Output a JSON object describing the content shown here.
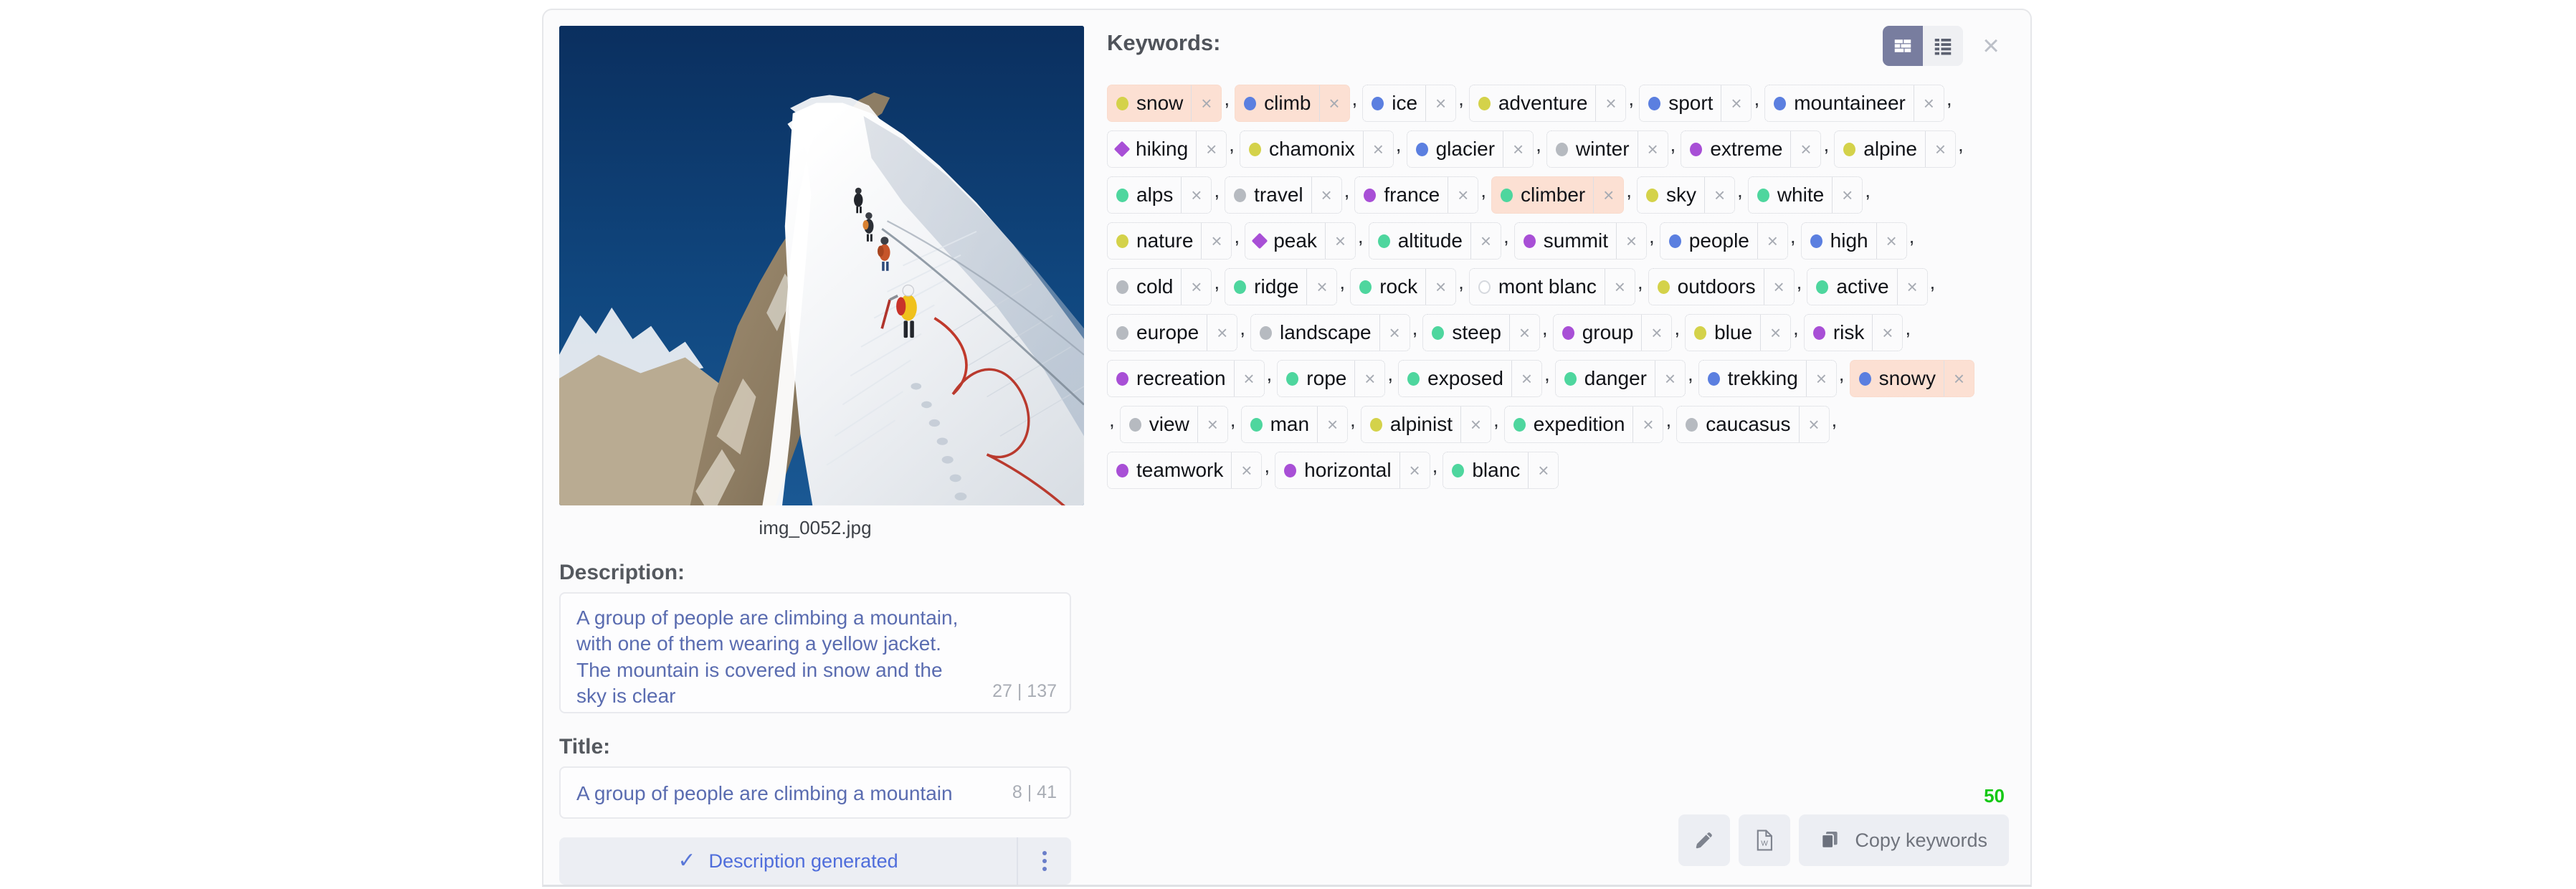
{
  "panel": {
    "keywords_label": "Keywords:",
    "close_label": "×",
    "keyword_count": "50",
    "copy_button_label": "Copy keywords"
  },
  "image": {
    "filename": "img_0052.jpg",
    "alt": "Climbers ascending a snow-covered mountain ridge under a deep blue sky"
  },
  "description": {
    "label": "Description:",
    "value": "A group of people are climbing a mountain, with one of them wearing a yellow jacket. The mountain is covered in snow and the sky is clear",
    "counter": "27 | 137"
  },
  "title": {
    "label": "Title:",
    "value": "A group of people are climbing a mountain",
    "counter": "8 | 41"
  },
  "status": {
    "text": "Description generated",
    "check": "✓"
  },
  "colors": {
    "olive": "#d4d24a",
    "blue": "#5b7fe0",
    "green": "#4ed69e",
    "purple": "#a84fd6",
    "gray": "#b6bac0",
    "hollow": "#ffffff",
    "highlight_bg": "#fce0d3",
    "accent_text": "#5a6cb0",
    "count_green": "#14c814"
  },
  "keywords": [
    {
      "label": "snow",
      "color": "#d4d24a",
      "shape": "circle",
      "highlight": true,
      "remove": "×",
      "sep": ","
    },
    {
      "label": "climb",
      "color": "#5b7fe0",
      "shape": "circle",
      "highlight": true,
      "remove": "×",
      "sep": ","
    },
    {
      "label": "ice",
      "color": "#5b7fe0",
      "shape": "circle",
      "highlight": false,
      "remove": "×",
      "sep": ","
    },
    {
      "label": "adventure",
      "color": "#d4d24a",
      "shape": "circle",
      "highlight": false,
      "remove": "×",
      "sep": ","
    },
    {
      "label": "sport",
      "color": "#5b7fe0",
      "shape": "circle",
      "highlight": false,
      "remove": "×",
      "sep": ","
    },
    {
      "label": "mountaineer",
      "color": "#5b7fe0",
      "shape": "circle",
      "highlight": false,
      "remove": "×",
      "sep": ","
    },
    {
      "label": "hiking",
      "color": "#a84fd6",
      "shape": "diamond",
      "highlight": false,
      "remove": "×",
      "sep": ","
    },
    {
      "label": "chamonix",
      "color": "#d4d24a",
      "shape": "circle",
      "highlight": false,
      "remove": "×",
      "sep": ","
    },
    {
      "label": "glacier",
      "color": "#5b7fe0",
      "shape": "circle",
      "highlight": false,
      "remove": "×",
      "sep": ","
    },
    {
      "label": "winter",
      "color": "#b6bac0",
      "shape": "circle",
      "highlight": false,
      "remove": "×",
      "sep": ","
    },
    {
      "label": "extreme",
      "color": "#a84fd6",
      "shape": "circle",
      "highlight": false,
      "remove": "×",
      "sep": ","
    },
    {
      "label": "alpine",
      "color": "#d4d24a",
      "shape": "circle",
      "highlight": false,
      "remove": "×",
      "sep": ","
    },
    {
      "label": "alps",
      "color": "#4ed69e",
      "shape": "circle",
      "highlight": false,
      "remove": "×",
      "sep": ","
    },
    {
      "label": "travel",
      "color": "#b6bac0",
      "shape": "circle",
      "highlight": false,
      "remove": "×",
      "sep": ","
    },
    {
      "label": "france",
      "color": "#a84fd6",
      "shape": "circle",
      "highlight": false,
      "remove": "×",
      "sep": ","
    },
    {
      "label": "climber",
      "color": "#4ed69e",
      "shape": "circle",
      "highlight": true,
      "remove": "×",
      "sep": ","
    },
    {
      "label": "sky",
      "color": "#d4d24a",
      "shape": "circle",
      "highlight": false,
      "remove": "×",
      "sep": ","
    },
    {
      "label": "white",
      "color": "#4ed69e",
      "shape": "circle",
      "highlight": false,
      "remove": "×",
      "sep": ","
    },
    {
      "label": "nature",
      "color": "#d4d24a",
      "shape": "circle",
      "highlight": false,
      "remove": "×",
      "sep": ","
    },
    {
      "label": "peak",
      "color": "#a84fd6",
      "shape": "diamond",
      "highlight": false,
      "remove": "×",
      "sep": ","
    },
    {
      "label": "altitude",
      "color": "#4ed69e",
      "shape": "circle",
      "highlight": false,
      "remove": "×",
      "sep": ","
    },
    {
      "label": "summit",
      "color": "#a84fd6",
      "shape": "circle",
      "highlight": false,
      "remove": "×",
      "sep": ","
    },
    {
      "label": "people",
      "color": "#5b7fe0",
      "shape": "circle",
      "highlight": false,
      "remove": "×",
      "sep": ","
    },
    {
      "label": "high",
      "color": "#5b7fe0",
      "shape": "circle",
      "highlight": false,
      "remove": "×",
      "sep": ","
    },
    {
      "label": "cold",
      "color": "#b6bac0",
      "shape": "circle",
      "highlight": false,
      "remove": "×",
      "sep": ","
    },
    {
      "label": "ridge",
      "color": "#4ed69e",
      "shape": "circle",
      "highlight": false,
      "remove": "×",
      "sep": ","
    },
    {
      "label": "rock",
      "color": "#4ed69e",
      "shape": "circle",
      "highlight": false,
      "remove": "×",
      "sep": ","
    },
    {
      "label": "mont blanc",
      "color": "#ffffff",
      "shape": "hollow",
      "highlight": false,
      "remove": "×",
      "sep": ","
    },
    {
      "label": "outdoors",
      "color": "#d4d24a",
      "shape": "circle",
      "highlight": false,
      "remove": "×",
      "sep": ","
    },
    {
      "label": "active",
      "color": "#4ed69e",
      "shape": "circle",
      "highlight": false,
      "remove": "×",
      "sep": ","
    },
    {
      "label": "europe",
      "color": "#b6bac0",
      "shape": "circle",
      "highlight": false,
      "remove": "×",
      "sep": ","
    },
    {
      "label": "landscape",
      "color": "#b6bac0",
      "shape": "circle",
      "highlight": false,
      "remove": "×",
      "sep": ","
    },
    {
      "label": "steep",
      "color": "#4ed69e",
      "shape": "circle",
      "highlight": false,
      "remove": "×",
      "sep": ","
    },
    {
      "label": "group",
      "color": "#a84fd6",
      "shape": "circle",
      "highlight": false,
      "remove": "×",
      "sep": ","
    },
    {
      "label": "blue",
      "color": "#d4d24a",
      "shape": "circle",
      "highlight": false,
      "remove": "×",
      "sep": ","
    },
    {
      "label": "risk",
      "color": "#a84fd6",
      "shape": "circle",
      "highlight": false,
      "remove": "×",
      "sep": ","
    },
    {
      "label": "recreation",
      "color": "#a84fd6",
      "shape": "circle",
      "highlight": false,
      "remove": "×",
      "sep": ","
    },
    {
      "label": "rope",
      "color": "#4ed69e",
      "shape": "circle",
      "highlight": false,
      "remove": "×",
      "sep": ","
    },
    {
      "label": "exposed",
      "color": "#4ed69e",
      "shape": "circle",
      "highlight": false,
      "remove": "×",
      "sep": ","
    },
    {
      "label": "danger",
      "color": "#4ed69e",
      "shape": "circle",
      "highlight": false,
      "remove": "×",
      "sep": ","
    },
    {
      "label": "trekking",
      "color": "#5b7fe0",
      "shape": "circle",
      "highlight": false,
      "remove": "×",
      "sep": ","
    },
    {
      "label": "snowy",
      "color": "#5b7fe0",
      "shape": "circle",
      "highlight": true,
      "remove": "×",
      "sep": ","
    },
    {
      "label": "view",
      "color": "#b6bac0",
      "shape": "circle",
      "highlight": false,
      "remove": "×",
      "sep": ","
    },
    {
      "label": "man",
      "color": "#4ed69e",
      "shape": "circle",
      "highlight": false,
      "remove": "×",
      "sep": ","
    },
    {
      "label": "alpinist",
      "color": "#d4d24a",
      "shape": "circle",
      "highlight": false,
      "remove": "×",
      "sep": ","
    },
    {
      "label": "expedition",
      "color": "#4ed69e",
      "shape": "circle",
      "highlight": false,
      "remove": "×",
      "sep": ","
    },
    {
      "label": "caucasus",
      "color": "#b6bac0",
      "shape": "circle",
      "highlight": false,
      "remove": "×",
      "sep": ","
    },
    {
      "label": "teamwork",
      "color": "#a84fd6",
      "shape": "circle",
      "highlight": false,
      "remove": "×",
      "sep": ","
    },
    {
      "label": "horizontal",
      "color": "#a84fd6",
      "shape": "circle",
      "highlight": false,
      "remove": "×",
      "sep": ","
    },
    {
      "label": "blanc",
      "color": "#4ed69e",
      "shape": "circle",
      "highlight": false,
      "remove": "×",
      "sep": ""
    }
  ],
  "view_modes": [
    {
      "name": "grid-view",
      "selected": true
    },
    {
      "name": "list-view",
      "selected": false
    }
  ]
}
